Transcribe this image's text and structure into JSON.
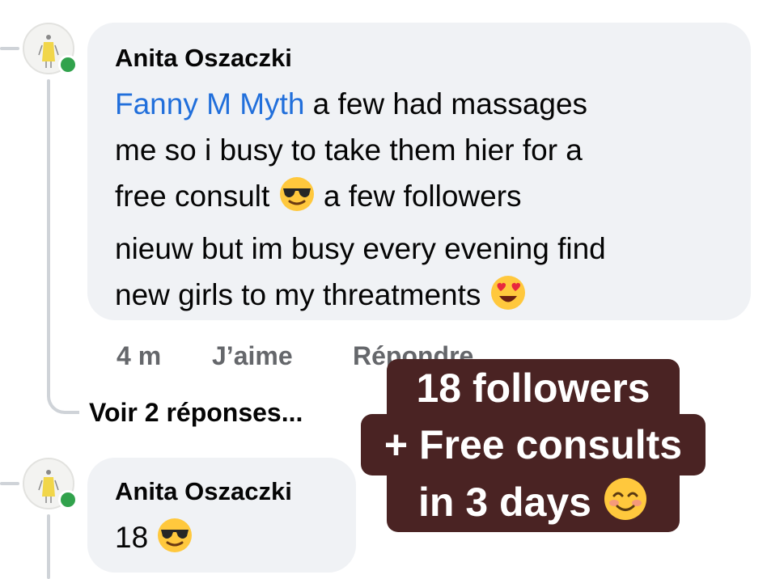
{
  "comments": [
    {
      "author": "Anita Oszaczki",
      "mention": "Fanny M Myth",
      "lines": [
        " a few  had massages",
        "me so i busy to take them hier for a",
        "free consult ",
        " a few followers",
        "nieuw but im busy every evening find",
        "new girls to my threatments "
      ],
      "emojis": [
        "smiling-face-with-sunglasses-icon",
        "smiling-face-with-heart-eyes-icon"
      ],
      "time": "4 m",
      "like_label": "J’aime",
      "reply_label": "Répondre",
      "view_replies_label": "Voir 2 réponses..."
    },
    {
      "author": "Anita Oszaczki",
      "text": "18 ",
      "emojis": [
        "smiling-face-with-sunglasses-icon"
      ]
    }
  ],
  "overlay": {
    "lines": [
      "18 followers",
      "+ Free consults",
      "in 3 days "
    ],
    "emoji": "smiling-face-with-smiling-eyes-icon",
    "background": "#4a2323",
    "text_color": "#ffffff"
  },
  "colors": {
    "mention": "#216fdb",
    "bubble": "#f0f2f5",
    "online": "#31a24c",
    "secondary_text": "#65676b"
  }
}
